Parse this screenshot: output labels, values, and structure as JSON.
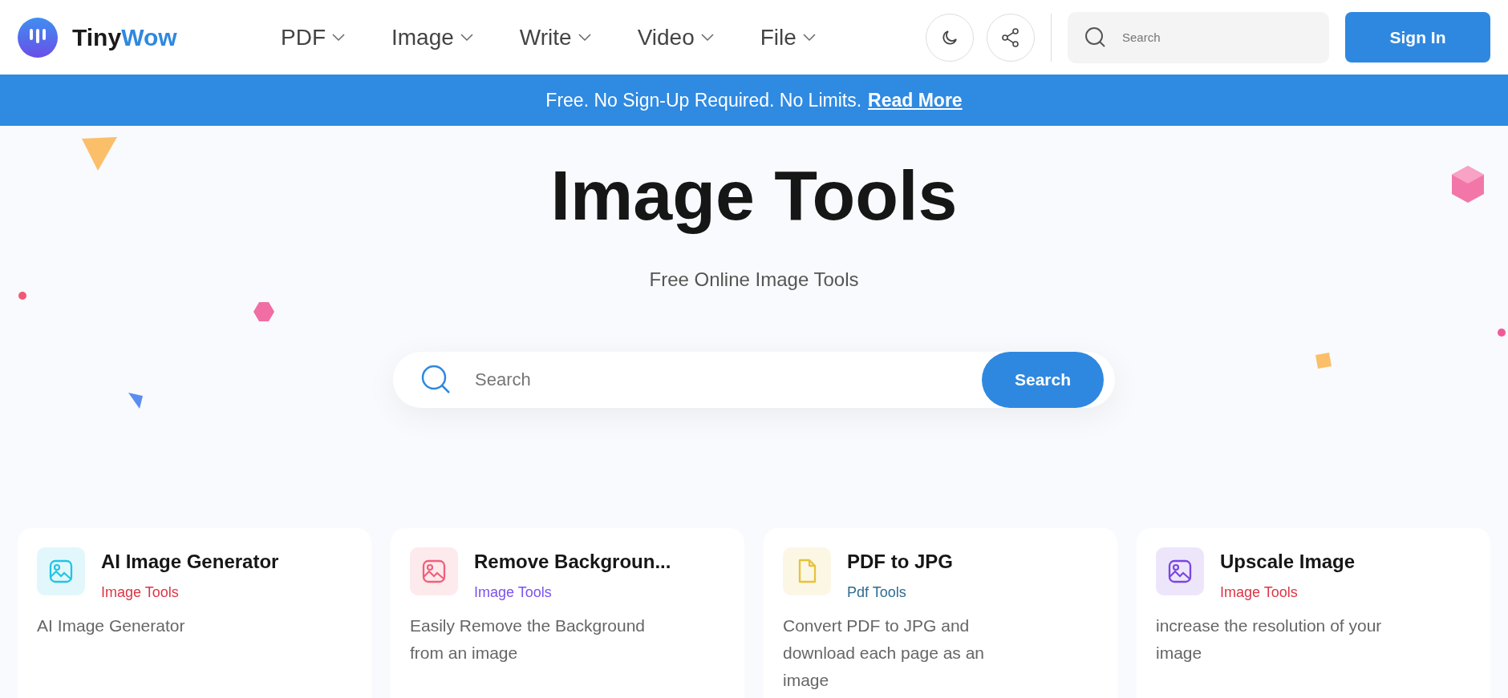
{
  "header": {
    "logo": {
      "first": "Tiny",
      "second": "Wow"
    },
    "nav": [
      {
        "label": "PDF"
      },
      {
        "label": "Image"
      },
      {
        "label": "Write"
      },
      {
        "label": "Video"
      },
      {
        "label": "File"
      }
    ],
    "search": {
      "placeholder": "Search"
    },
    "sign_in": "Sign In"
  },
  "banner": {
    "text": "Free. No Sign-Up Required. No Limits.",
    "link": "Read More"
  },
  "hero": {
    "title": "Image Tools",
    "subtitle": "Free Online Image Tools",
    "search": {
      "placeholder": "Search",
      "button": "Search"
    }
  },
  "cards": [
    {
      "title": "AI Image Generator",
      "tag": "Image Tools",
      "color": "#dc3545",
      "kind": "image",
      "description": "AI Image Generator"
    },
    {
      "title": "Remove Backgroun...",
      "tag": "Image Tools",
      "color": "#7b52ee",
      "kind": "image",
      "description": "Easily Remove the Background from an image"
    },
    {
      "title": "PDF to JPG",
      "tag": "Pdf Tools",
      "color": "#2e6b8f",
      "kind": "file",
      "description": "Convert PDF to JPG and download each page as an image"
    },
    {
      "title": "Upscale Image",
      "tag": "Image Tools",
      "color": "#dc3545",
      "kind": "image",
      "description": "increase the resolution of your image"
    }
  ]
}
